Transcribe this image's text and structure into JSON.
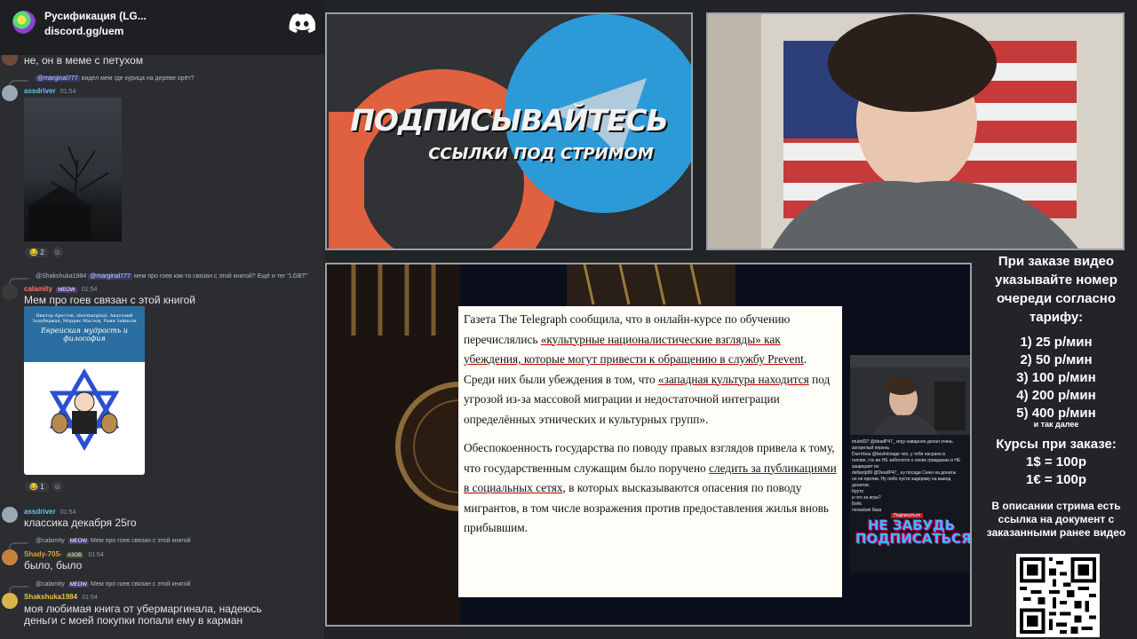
{
  "colors": {
    "chat_bg": "#2b2d31",
    "username_assdriver": "#5dc8f0",
    "username_calamity": "#ff7a59",
    "username_shaky": "#e5a13c",
    "username_shakshuka": "#f0c24a",
    "info_text": "#ffffff"
  },
  "discord": {
    "server_name": "Русификация (LG...",
    "invite": "discord.gg/uem",
    "icon": "discord-logo-icon",
    "messages": [
      {
        "text": "не, он в меме с петухом"
      },
      {
        "reply_mention": "@marginal777",
        "reply_text": "видел мем где курица на дереве орёт?",
        "author": "assdriver",
        "time": "01:54",
        "reaction_count": "2"
      },
      {
        "reply_author": "@Shakshuka1984",
        "reply_mention": "@marginal777",
        "reply_text": "мем про гоев как-то связан с этой книгой? Ещё и тег \"LGBT\"",
        "author": "calamity",
        "badge": "MEOW",
        "time": "01:54",
        "text": "Мем про гоев связан с этой книгой",
        "book_authors": "Виктор Арестов, ubermarginal, Анатолий Зольберман, Моррис Маслов, Рами Зайнали",
        "book_title": "Еврейская мудрость и философия",
        "reaction_count": "1"
      },
      {
        "author": "assdriver",
        "time": "01:54",
        "text": "классика декабря 25го"
      },
      {
        "reply_author": "@calamity",
        "reply_badge": "MEOW",
        "reply_text": "Мем про гоев связан с этой книгой",
        "author": "Shady-705-",
        "badge": "АЗОВ",
        "time": "01:54",
        "text": "было, было"
      },
      {
        "reply_author": "@calamity",
        "reply_badge": "MEOW",
        "reply_text": "Мем про гоев связан с этой книгой",
        "author": "Shakshuka1984",
        "time": "01:54",
        "text_line1": "моя любимая книга от убермаргинала, надеюсь",
        "text_line2": "деньги с моей покупки попали ему в карман"
      }
    ]
  },
  "promo": {
    "title": "ПОДПИСЫВАЙТЕСЬ",
    "subtitle": "ССЫЛКИ ПОД СТРИМОМ"
  },
  "article": {
    "p1_a": "Газета The Telegraph сообщила, что в онлайн-курсе по обучению перечислялись ",
    "p1_link1": "«культурные националистические взгляды» как убеждения, которые могут привести к обращению в службу Prevent",
    "p1_b": ". Среди них были убеждения в том, что ",
    "p1_link2": "«западная культура находится",
    "p1_c": " под угрозой из-за массовой миграции и недостаточной интеграции определённых этнических и культурных групп».",
    "p2_a": "Обеспокоенность государства по поводу правых взглядов привела к тому, что государственным служащим было поручено ",
    "p2_link": "следить за публикациями в социальных сетях",
    "p2_b": ", в которых высказываются опасения по поводу мигрантов, в том числе возражения против предоставления жилья вновь прибывшим."
  },
  "pip": {
    "chat_lines": [
      "mute837  @deadP47_ игру наварное делал очень",
      "загорелый перень",
      "Durrrrbuu  @beshinnage чел, у тебя насрано в",
      "голове, гос-во НЕ заботится о своих гражданах и НЕ",
      "защищает их",
      "deltaxtp99  @DeadP47_ ну посади Сеню на донаты",
      "он не против. Ну либо пусти задержку на вывод",
      "донатов.",
      "Круто",
      "а что за игра?",
      "Бейс",
      "novastuel  база"
    ],
    "tag": "Подписаться",
    "banner_line1": "НЕ ЗАБУДЬ",
    "banner_line2": "ПОДПИСАТЬСЯ!"
  },
  "info": {
    "header": "При заказе видео указывайте номер очереди согласно тарифу:",
    "tariffs": [
      "1) 25 р/мин",
      "2) 50 р/мин",
      "3) 100 р/мин",
      "4) 200 р/мин",
      "5) 400 р/мин"
    ],
    "tariff_more": "и так далее",
    "courses_header": "Курсы при заказе:",
    "courses": [
      "1$ = 100р",
      "1€ = 100р"
    ],
    "note": "В описании стрима есть ссылка на документ с заказанными ранее видео"
  }
}
